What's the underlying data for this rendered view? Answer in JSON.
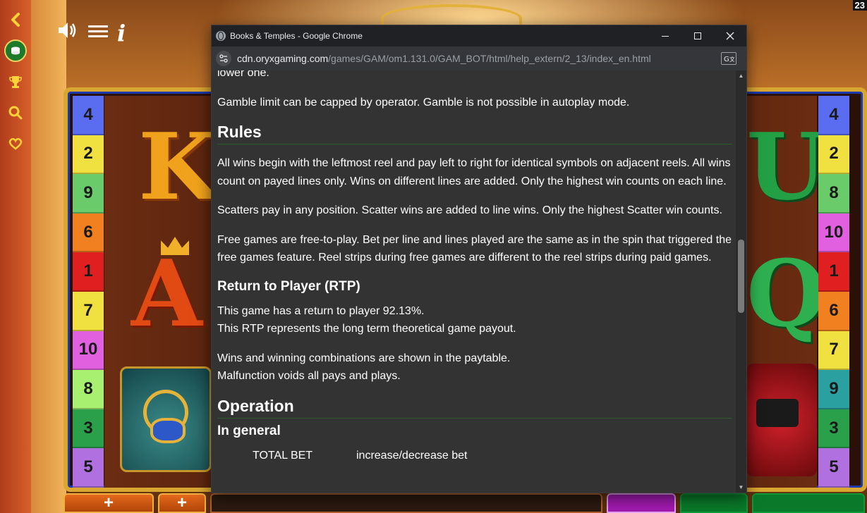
{
  "game": {
    "corner_number": "23",
    "line_numbers_left": [
      "4",
      "2",
      "9",
      "6",
      "1",
      "7",
      "10",
      "8",
      "3",
      "5"
    ],
    "line_numbers_right": [
      "4",
      "2",
      "8",
      "10",
      "1",
      "6",
      "7",
      "9",
      "3",
      "5"
    ],
    "line_colors_left": [
      "#5a6df0",
      "#f0e040",
      "#6acb6a",
      "#f08020",
      "#e02020",
      "#f0e040",
      "#e060e0",
      "#a8f070",
      "#2aa04a",
      "#b070e0"
    ],
    "line_colors_right": [
      "#5a6df0",
      "#f0e040",
      "#6acb6a",
      "#e060e0",
      "#e02020",
      "#f08020",
      "#f0e040",
      "#2aa0a0",
      "#2aa04a",
      "#b070e0"
    ],
    "symbols": {
      "k": "K",
      "a": "A",
      "u": "U",
      "q": "Q"
    },
    "bottom_plus_label": "+",
    "icons": {
      "back": "chevron-left-icon",
      "coin": "coin-icon",
      "trophy": "trophy-icon",
      "search": "search-icon",
      "heart": "heart-icon",
      "sound": "speaker-icon",
      "menu": "hamburger-icon",
      "info": "info-icon"
    },
    "info_symbol": "i"
  },
  "browser": {
    "title": "Books & Temples - Google Chrome",
    "url_host": "cdn.oryxgaming.com",
    "url_path": "/games/GAM/om1.131.0/GAM_BOT/html/help_extern/2_13/index_en.html"
  },
  "help": {
    "partial_top": "lower one.",
    "gamble_limit": "Gamble limit can be capped by operator. Gamble is not possible in autoplay mode.",
    "rules_heading": "Rules",
    "rules_p1": "All wins begin with the leftmost reel and pay left to right for identical symbols on adjacent reels. All wins count on payed lines only. Wins on different lines are added. Only the highest win counts on each line.",
    "rules_p2": "Scatters pay in any position. Scatter wins are added to line wins. Only the highest Scatter win counts.",
    "rules_p3": "Free games are free-to-play. Bet per line and lines played are the same as in the spin that triggered the free games feature. Reel strips during free games are different to the reel strips during paid games.",
    "rtp_heading": "Return to Player (RTP)",
    "rtp_line1": "This game has a return to player 92.13%.",
    "rtp_line2": "This RTP represents the long term theoretical game payout.",
    "wins_line1": "Wins and winning combinations are shown in the paytable.",
    "wins_line2": "Malfunction voids all pays and plays.",
    "operation_heading": "Operation",
    "in_general_heading": "In general",
    "op_key": "TOTAL BET",
    "op_value": "increase/decrease bet"
  }
}
